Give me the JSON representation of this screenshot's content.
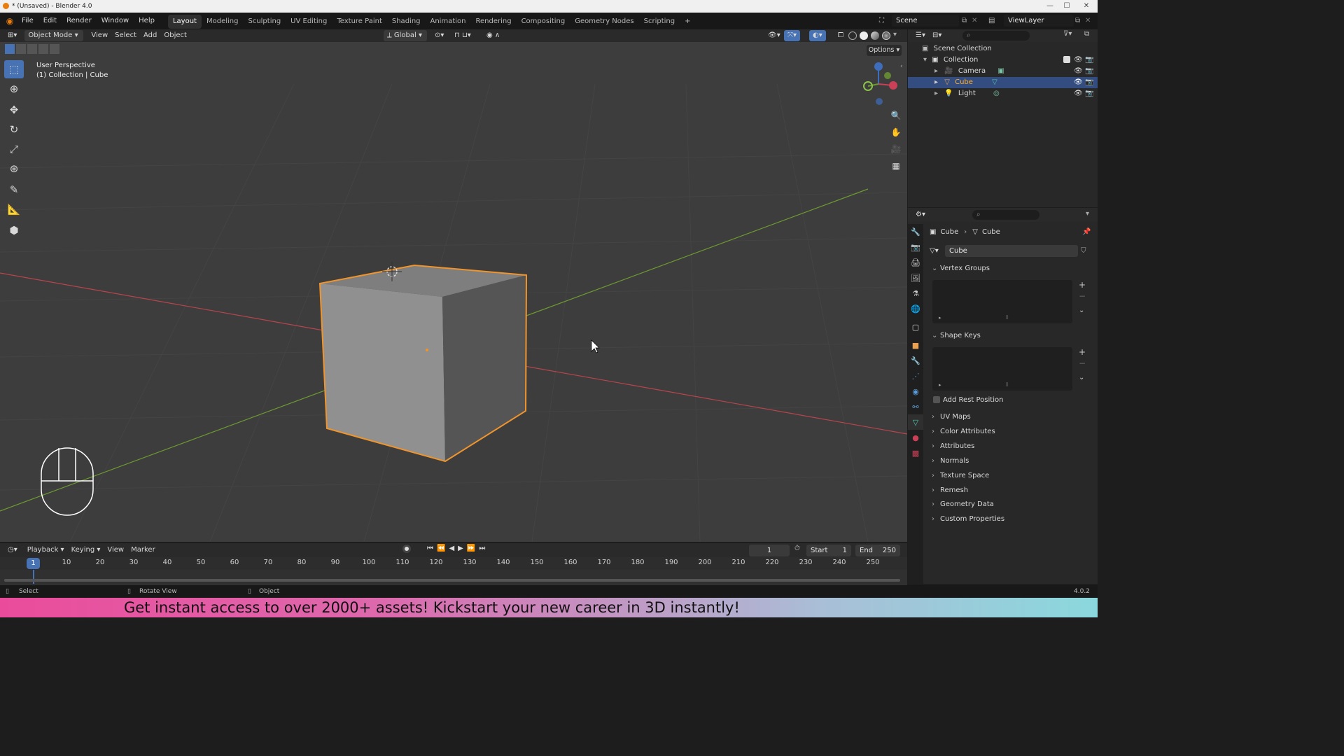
{
  "window": {
    "title": "* (Unsaved) - Blender 4.0"
  },
  "menu": [
    "File",
    "Edit",
    "Render",
    "Window",
    "Help"
  ],
  "workspaces": [
    {
      "label": "Layout",
      "active": true
    },
    {
      "label": "Modeling"
    },
    {
      "label": "Sculpting"
    },
    {
      "label": "UV Editing"
    },
    {
      "label": "Texture Paint"
    },
    {
      "label": "Shading"
    },
    {
      "label": "Animation"
    },
    {
      "label": "Rendering"
    },
    {
      "label": "Compositing"
    },
    {
      "label": "Geometry Nodes"
    },
    {
      "label": "Scripting"
    }
  ],
  "add_workspace": "+",
  "scene": {
    "name": "Scene",
    "view_layer": "ViewLayer"
  },
  "viewport": {
    "mode": "Object Mode",
    "menus": [
      "View",
      "Select",
      "Add",
      "Object"
    ],
    "transform_orientation": "Global",
    "options_label": "Options",
    "overlay_line1": "User Perspective",
    "overlay_line2": "(1) Collection | Cube",
    "gizmo_axis": "Z"
  },
  "outliner": {
    "root": "Scene Collection",
    "collection": "Collection",
    "items": [
      {
        "label": "Camera",
        "selected": false
      },
      {
        "label": "Cube",
        "selected": true
      },
      {
        "label": "Light",
        "selected": false
      }
    ]
  },
  "properties": {
    "breadcrumb_object": "Cube",
    "breadcrumb_data": "Cube",
    "mesh_name": "Cube",
    "panels": {
      "vertex_groups": "Vertex Groups",
      "shape_keys": "Shape Keys",
      "add_rest_position": "Add Rest Position",
      "collapsed": [
        "UV Maps",
        "Color Attributes",
        "Attributes",
        "Normals",
        "Texture Space",
        "Remesh",
        "Geometry Data",
        "Custom Properties"
      ]
    }
  },
  "timeline": {
    "menus": [
      "Playback",
      "Keying",
      "View",
      "Marker"
    ],
    "current_frame": "1",
    "start_label": "Start",
    "start_value": "1",
    "end_label": "End",
    "end_value": "250",
    "ticks": [
      "10",
      "20",
      "30",
      "40",
      "50",
      "60",
      "70",
      "80",
      "90",
      "100",
      "110",
      "120",
      "130",
      "140",
      "150",
      "160",
      "170",
      "180",
      "190",
      "200",
      "210",
      "220",
      "230",
      "240",
      "250"
    ]
  },
  "statusbar": {
    "left": "Select",
    "middle": "Rotate View",
    "right": "Object",
    "version": "4.0.2"
  },
  "banner": {
    "text": "Get instant access to over 2000+ assets! Kickstart your new career in 3D instantly!"
  },
  "colors": {
    "accent": "#4772b3",
    "selection_outline": "#f0952d",
    "x_axis": "#b8454e",
    "y_axis": "#6e9a32"
  }
}
